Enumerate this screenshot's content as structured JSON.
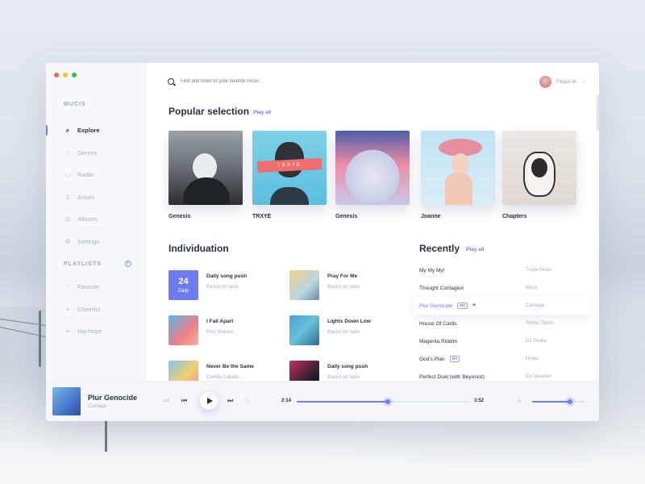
{
  "window": {
    "dot_colors": [
      "#ff6159",
      "#ffbd2e",
      "#28c941"
    ]
  },
  "sidebar": {
    "app_name": "MUCIS",
    "nav": [
      {
        "label": "Explore",
        "icon": "search-icon",
        "active": true
      },
      {
        "label": "Genres",
        "icon": "grid-icon"
      },
      {
        "label": "Radio",
        "icon": "radio-icon"
      },
      {
        "label": "Artists",
        "icon": "user-icon"
      },
      {
        "label": "Albums",
        "icon": "disc-icon"
      },
      {
        "label": "Settings",
        "icon": "gear-icon"
      }
    ],
    "playlists_heading": "PLAYLISTS",
    "playlists": [
      {
        "label": "Favorite",
        "icon": "heart-icon"
      },
      {
        "label": "Cheerful",
        "icon": "list-icon"
      },
      {
        "label": "Hip-hope",
        "icon": "list-icon"
      }
    ]
  },
  "header": {
    "search_placeholder": "Find and listen to your favorite music",
    "user_name": "Filippe M."
  },
  "popular": {
    "title": "Popular selection",
    "play_all": "Play all",
    "albums": [
      {
        "title": "Genesis",
        "cover_text": ""
      },
      {
        "title": "TRXYE",
        "cover_text": "TRXYE"
      },
      {
        "title": "Genesis",
        "cover_text": ""
      },
      {
        "title": "Joanne",
        "cover_text": ""
      },
      {
        "title": "Chapters",
        "cover_text": ""
      }
    ]
  },
  "individuation": {
    "title": "Individuation",
    "items": [
      {
        "title": "Daily song push",
        "sub": "Based on taste",
        "day": "24",
        "day_label": "Daily"
      },
      {
        "title": "Pray For Me",
        "sub": "Based on taste"
      },
      {
        "title": "I Fall Apart",
        "sub": "Post Malone"
      },
      {
        "title": "Lights Down Low",
        "sub": "Based on taste"
      },
      {
        "title": "Never Be the Same",
        "sub": "Camila Cabello"
      },
      {
        "title": "Daily song push",
        "sub": "Based on taste"
      }
    ]
  },
  "recently": {
    "title": "Recently",
    "play_all": "Play all",
    "rows": [
      {
        "title": "My My My!",
        "artist": "Troye Sivan"
      },
      {
        "title": "Thought Contagion",
        "artist": "Muse"
      },
      {
        "title": "Plur Genocide",
        "artist": "Carnage",
        "badge": "MV",
        "playing": true
      },
      {
        "title": "House Of Cards",
        "artist": "Sidnie Tipton"
      },
      {
        "title": "Magenta Riddim",
        "artist": "DJ Snake"
      },
      {
        "title": "God's Plan",
        "artist": "Drake",
        "badge": "MV"
      },
      {
        "title": "Perfect Duet (with Beyoncé)",
        "artist": "Ed Sheeran"
      }
    ]
  },
  "player": {
    "title": "Plur Genocide",
    "artist": "Carnage",
    "current_time": "2:14",
    "total_time": "3:52",
    "progress": 0.53,
    "volume": 0.71
  },
  "accent_color": "#6c7cf3"
}
